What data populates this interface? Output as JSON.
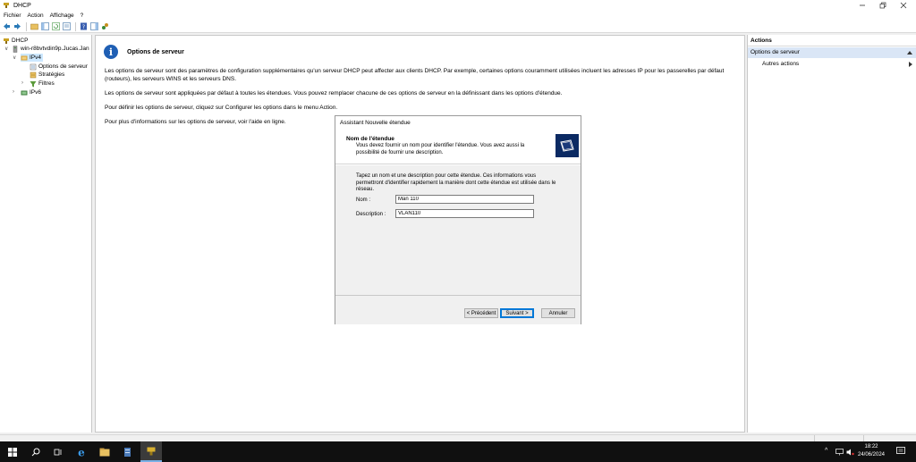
{
  "window": {
    "title": "DHCP"
  },
  "menu": {
    "items": [
      "Fichier",
      "Action",
      "Affichage",
      "?"
    ]
  },
  "tree": {
    "root": "DHCP",
    "server": "win-r8bvtvdin9p.Jucas.Jan",
    "ipv4": "IPv4",
    "server_options": "Options de serveur",
    "policies": "Stratégies",
    "filters": "Filtres",
    "ipv6": "IPv6"
  },
  "main": {
    "header_title": "Options de serveur",
    "para1": "Les options de serveur sont des paramètres de configuration supplémentaires qu'un serveur DHCP peut affecter aux clients DHCP. Par exemple, certaines options couramment utilisées incluent les adresses IP pour les passerelles par défaut (routeurs), les serveurs WINS et les serveurs DNS.",
    "para2": "Les options de serveur sont appliquées par défaut à toutes les étendues. Vous pouvez remplacer chacune de ces options de serveur en la définissant dans les options d'étendue.",
    "para3": "Pour définir les options de serveur, cliquez sur Configurer les options dans le menu Action.",
    "para4": "Pour plus d'informations sur les options de serveur, voir l'aide en ligne."
  },
  "wizard": {
    "title": "Assistant Nouvelle étendue",
    "header_title": "Nom de l'étendue",
    "header_desc": "Vous devez fournir un nom pour identifier l'étendue. Vous avez aussi la possibilité de fournir une description.",
    "intro": "Tapez un nom et une description pour cette étendue. Ces informations vous permettront d'identifier rapidement la manière dont cette étendue est utilisée dans le réseau.",
    "name_label": "Nom :",
    "name_value": "Man 110",
    "description_label": "Description :",
    "description_value": "VLAN110",
    "back_button": "< Précédent",
    "next_button": "Suivant >",
    "cancel_button": "Annuler"
  },
  "actions": {
    "header": "Actions",
    "section": "Options de serveur",
    "more": "Autres actions"
  },
  "taskbar": {
    "time": "18:22",
    "date": "24/06/2024"
  }
}
